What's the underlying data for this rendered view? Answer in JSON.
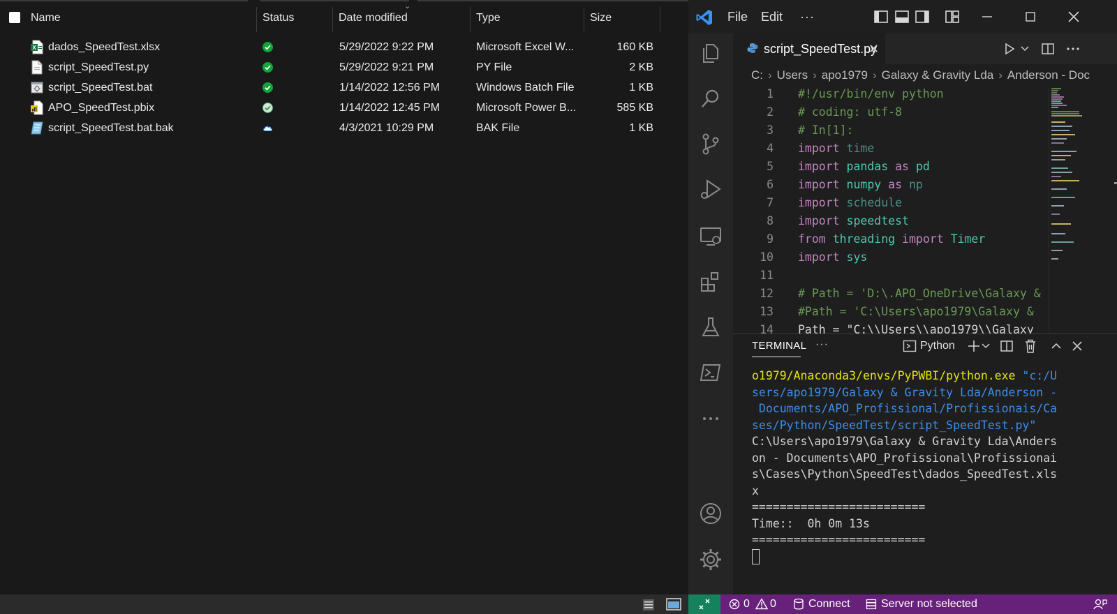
{
  "explorer": {
    "columns": {
      "name": "Name",
      "status": "Status",
      "date": "Date modified",
      "type": "Type",
      "size": "Size"
    },
    "files": [
      {
        "name": "dados_SpeedTest.xlsx",
        "date": "5/29/2022 9:22 PM",
        "type": "Microsoft Excel W...",
        "size": "160 KB",
        "icon": "excel-file-icon",
        "status": "synced-green"
      },
      {
        "name": "script_SpeedTest.py",
        "date": "5/29/2022 9:21 PM",
        "type": "PY File",
        "size": "2 KB",
        "icon": "text-file-icon",
        "status": "synced-green"
      },
      {
        "name": "script_SpeedTest.bat",
        "date": "1/14/2022 12:56 PM",
        "type": "Windows Batch File",
        "size": "1 KB",
        "icon": "batch-file-icon",
        "status": "synced-green"
      },
      {
        "name": "APO_SpeedTest.pbix",
        "date": "1/14/2022 12:45 PM",
        "type": "Microsoft Power B...",
        "size": "585 KB",
        "icon": "powerbi-file-icon",
        "status": "available-outline"
      },
      {
        "name": "script_SpeedTest.bat.bak",
        "date": "4/3/2021 10:29 PM",
        "type": "BAK File",
        "size": "1 KB",
        "icon": "bak-file-icon",
        "status": "cloud-only"
      }
    ]
  },
  "vscode": {
    "menu": {
      "file": "File",
      "edit": "Edit",
      "more": "···"
    },
    "tab_label": "script_SpeedTest.py",
    "breadcrumb": [
      "C:",
      "Users",
      "apo1979",
      "Galaxy & Gravity Lda",
      "Anderson - Doc"
    ],
    "code": [
      {
        "n": "1",
        "parts": [
          [
            "c",
            "#!/usr/bin/env python"
          ]
        ]
      },
      {
        "n": "2",
        "parts": [
          [
            "c",
            "# coding: utf-8"
          ]
        ]
      },
      {
        "n": "3",
        "parts": [
          [
            "c",
            "# In[1]:"
          ]
        ]
      },
      {
        "n": "4",
        "parts": [
          [
            "k",
            "import"
          ],
          [
            "p",
            " "
          ],
          [
            "d",
            "time"
          ]
        ]
      },
      {
        "n": "5",
        "parts": [
          [
            "k",
            "import"
          ],
          [
            "p",
            " "
          ],
          [
            "m",
            "pandas"
          ],
          [
            "p",
            " "
          ],
          [
            "k",
            "as"
          ],
          [
            "p",
            " "
          ],
          [
            "m",
            "pd"
          ]
        ]
      },
      {
        "n": "6",
        "parts": [
          [
            "k",
            "import"
          ],
          [
            "p",
            " "
          ],
          [
            "m",
            "numpy"
          ],
          [
            "p",
            " "
          ],
          [
            "k",
            "as"
          ],
          [
            "p",
            " "
          ],
          [
            "d",
            "np"
          ]
        ]
      },
      {
        "n": "7",
        "parts": [
          [
            "k",
            "import"
          ],
          [
            "p",
            " "
          ],
          [
            "d",
            "schedule"
          ]
        ]
      },
      {
        "n": "8",
        "parts": [
          [
            "k",
            "import"
          ],
          [
            "p",
            " "
          ],
          [
            "m",
            "speedtest"
          ]
        ]
      },
      {
        "n": "9",
        "parts": [
          [
            "k",
            "from"
          ],
          [
            "p",
            " "
          ],
          [
            "m",
            "threading"
          ],
          [
            "p",
            " "
          ],
          [
            "k",
            "import"
          ],
          [
            "p",
            " "
          ],
          [
            "m",
            "Timer"
          ]
        ]
      },
      {
        "n": "10",
        "parts": [
          [
            "k",
            "import"
          ],
          [
            "p",
            " "
          ],
          [
            "m",
            "sys"
          ]
        ]
      },
      {
        "n": "11",
        "parts": []
      },
      {
        "n": "12",
        "parts": [
          [
            "c",
            "# Path = 'D:\\.APO_OneDrive\\Galaxy &"
          ]
        ]
      },
      {
        "n": "13",
        "parts": [
          [
            "c",
            "#Path = 'C:\\Users\\apo1979\\Galaxy &"
          ]
        ]
      },
      {
        "n": "14",
        "parts": [
          [
            "p",
            "Path = \"C:\\\\Users\\\\apo1979\\\\Galaxy"
          ]
        ]
      }
    ],
    "panel": {
      "tab": "TERMINAL",
      "more": "···",
      "shell": "Python"
    },
    "terminal_lines": [
      {
        "segs": [
          [
            "y",
            "o1979/Anaconda3/envs/PyPWBI/python.exe "
          ],
          [
            "b",
            "\"c:/U"
          ]
        ]
      },
      {
        "segs": [
          [
            "b",
            "sers/apo1979/Galaxy & Gravity Lda/Anderson -"
          ]
        ]
      },
      {
        "segs": [
          [
            "b",
            " Documents/APO_Profissional/Profissionais/Ca"
          ]
        ]
      },
      {
        "segs": [
          [
            "b",
            "ses/Python/SpeedTest/script_SpeedTest.py\""
          ]
        ]
      },
      {
        "segs": [
          [
            "w",
            "C:\\Users\\apo1979\\Galaxy & Gravity Lda\\Anders"
          ]
        ]
      },
      {
        "segs": [
          [
            "w",
            "on - Documents\\APO_Profissional\\Profissionai"
          ]
        ]
      },
      {
        "segs": [
          [
            "w",
            "s\\Cases\\Python\\SpeedTest\\dados_SpeedTest.xls"
          ]
        ]
      },
      {
        "segs": [
          [
            "w",
            "x"
          ]
        ]
      },
      {
        "segs": [
          [
            "w",
            "========================="
          ]
        ]
      },
      {
        "segs": [
          [
            "w",
            "Time::  0h 0m 13s"
          ]
        ]
      },
      {
        "segs": [
          [
            "w",
            "========================="
          ]
        ]
      }
    ],
    "status": {
      "errors": "0",
      "warnings": "0",
      "connect": "Connect",
      "server": "Server not selected"
    },
    "colors": {
      "status_bg": "#68217a",
      "remote_bg": "#16825d",
      "accent_blue": "#3794ff"
    }
  }
}
